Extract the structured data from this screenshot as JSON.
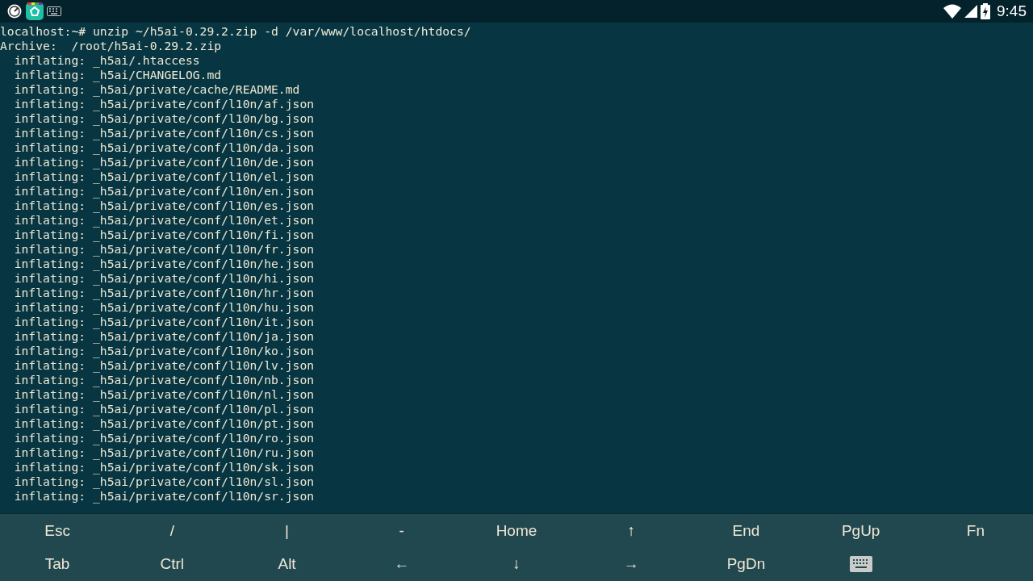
{
  "status_bar": {
    "time": "9:45"
  },
  "terminal": {
    "lines": [
      "localhost:~# unzip ~/h5ai-0.29.2.zip -d /var/www/localhost/htdocs/",
      "Archive:  /root/h5ai-0.29.2.zip",
      "  inflating: _h5ai/.htaccess",
      "  inflating: _h5ai/CHANGELOG.md",
      "  inflating: _h5ai/private/cache/README.md",
      "  inflating: _h5ai/private/conf/l10n/af.json",
      "  inflating: _h5ai/private/conf/l10n/bg.json",
      "  inflating: _h5ai/private/conf/l10n/cs.json",
      "  inflating: _h5ai/private/conf/l10n/da.json",
      "  inflating: _h5ai/private/conf/l10n/de.json",
      "  inflating: _h5ai/private/conf/l10n/el.json",
      "  inflating: _h5ai/private/conf/l10n/en.json",
      "  inflating: _h5ai/private/conf/l10n/es.json",
      "  inflating: _h5ai/private/conf/l10n/et.json",
      "  inflating: _h5ai/private/conf/l10n/fi.json",
      "  inflating: _h5ai/private/conf/l10n/fr.json",
      "  inflating: _h5ai/private/conf/l10n/he.json",
      "  inflating: _h5ai/private/conf/l10n/hi.json",
      "  inflating: _h5ai/private/conf/l10n/hr.json",
      "  inflating: _h5ai/private/conf/l10n/hu.json",
      "  inflating: _h5ai/private/conf/l10n/it.json",
      "  inflating: _h5ai/private/conf/l10n/ja.json",
      "  inflating: _h5ai/private/conf/l10n/ko.json",
      "  inflating: _h5ai/private/conf/l10n/lv.json",
      "  inflating: _h5ai/private/conf/l10n/nb.json",
      "  inflating: _h5ai/private/conf/l10n/nl.json",
      "  inflating: _h5ai/private/conf/l10n/pl.json",
      "  inflating: _h5ai/private/conf/l10n/pt.json",
      "  inflating: _h5ai/private/conf/l10n/ro.json",
      "  inflating: _h5ai/private/conf/l10n/ru.json",
      "  inflating: _h5ai/private/conf/l10n/sk.json",
      "  inflating: _h5ai/private/conf/l10n/sl.json",
      "  inflating: _h5ai/private/conf/l10n/sr.json"
    ]
  },
  "extra_keys": [
    [
      {
        "kind": "text",
        "label": "Esc"
      },
      {
        "kind": "text",
        "label": "/"
      },
      {
        "kind": "text",
        "label": "|"
      },
      {
        "kind": "text",
        "label": "-"
      },
      {
        "kind": "text",
        "label": "Home"
      },
      {
        "kind": "text",
        "label": "↑"
      },
      {
        "kind": "text",
        "label": "End"
      },
      {
        "kind": "text",
        "label": "PgUp"
      },
      {
        "kind": "text",
        "label": "Fn"
      }
    ],
    [
      {
        "kind": "text",
        "label": "Tab"
      },
      {
        "kind": "text",
        "label": "Ctrl"
      },
      {
        "kind": "text",
        "label": "Alt"
      },
      {
        "kind": "text",
        "label": "←"
      },
      {
        "kind": "text",
        "label": "↓"
      },
      {
        "kind": "text",
        "label": "→"
      },
      {
        "kind": "text",
        "label": "PgDn"
      },
      {
        "kind": "keyboard"
      },
      {
        "kind": "empty"
      }
    ]
  ]
}
